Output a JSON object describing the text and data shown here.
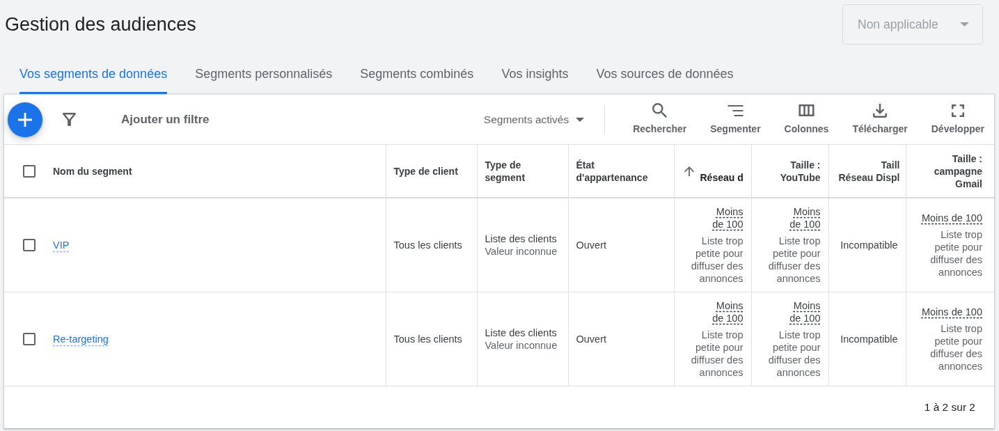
{
  "page": {
    "title": "Gestion des audiences"
  },
  "account_dropdown": {
    "value": "Non applicable",
    "disabled": true
  },
  "tabs": [
    {
      "label": "Vos segments de données",
      "selected": true
    },
    {
      "label": "Segments personnalisés",
      "selected": false
    },
    {
      "label": "Segments combinés",
      "selected": false
    },
    {
      "label": "Vos insights",
      "selected": false
    },
    {
      "label": "Vos sources de données",
      "selected": false
    }
  ],
  "toolbar": {
    "add_filter": "Ajouter un filtre",
    "segment_filter": "Segments activés",
    "actions": [
      {
        "kind": "search",
        "label": "Rechercher"
      },
      {
        "kind": "segment",
        "label": "Segmenter"
      },
      {
        "kind": "columns",
        "label": "Colonnes"
      },
      {
        "kind": "download",
        "label": "Télécharger"
      },
      {
        "kind": "expand",
        "label": "Développer"
      }
    ]
  },
  "table": {
    "select_all": {
      "checked": false
    },
    "columns": [
      {
        "label": "Nom du segment",
        "sorted": false
      },
      {
        "label": "Type de client",
        "sorted": false
      },
      {
        "label": "Type de\nsegment",
        "sorted": false
      },
      {
        "label": "État\nd'appartenance",
        "sorted": false
      },
      {
        "label": "Réseau d",
        "sorted": true
      },
      {
        "label": "Taille :\nYouTube",
        "sorted": false
      },
      {
        "label": "Taill\nRéseau Displ",
        "sorted": false
      },
      {
        "label": "Taille :\ncampagne\nGmail",
        "sorted": false
      }
    ],
    "rows": [
      {
        "selected": false,
        "name": "VIP",
        "client_type": "Tous les clients",
        "segment_type": "Liste des clients",
        "segment_detail": "Valeur inconnue",
        "membership": "Ouvert",
        "sizes": [
          {
            "kind": "estimate",
            "value": "Moins de 100",
            "note": "Liste trop petite pour diffuser des annonces"
          },
          {
            "kind": "estimate",
            "value": "Moins de 100",
            "note": "Liste trop petite pour diffuser des annonces"
          },
          {
            "kind": "status",
            "value": "Incompatible"
          },
          {
            "kind": "estimate",
            "value": "Moins de 100",
            "note": "Liste trop petite pour diffuser des annonces"
          }
        ]
      },
      {
        "selected": false,
        "name": "Re-targeting",
        "client_type": "Tous les clients",
        "segment_type": "Liste des clients",
        "segment_detail": "Valeur inconnue",
        "membership": "Ouvert",
        "sizes": [
          {
            "kind": "estimate",
            "value": "Moins de 100",
            "note": "Liste trop petite pour diffuser des annonces"
          },
          {
            "kind": "estimate",
            "value": "Moins de 100",
            "note": "Liste trop petite pour diffuser des annonces"
          },
          {
            "kind": "status",
            "value": "Incompatible"
          },
          {
            "kind": "estimate",
            "value": "Moins de 100",
            "note": "Liste trop petite pour diffuser des annonces"
          }
        ]
      }
    ],
    "pagination": "1 à 2 sur 2"
  }
}
